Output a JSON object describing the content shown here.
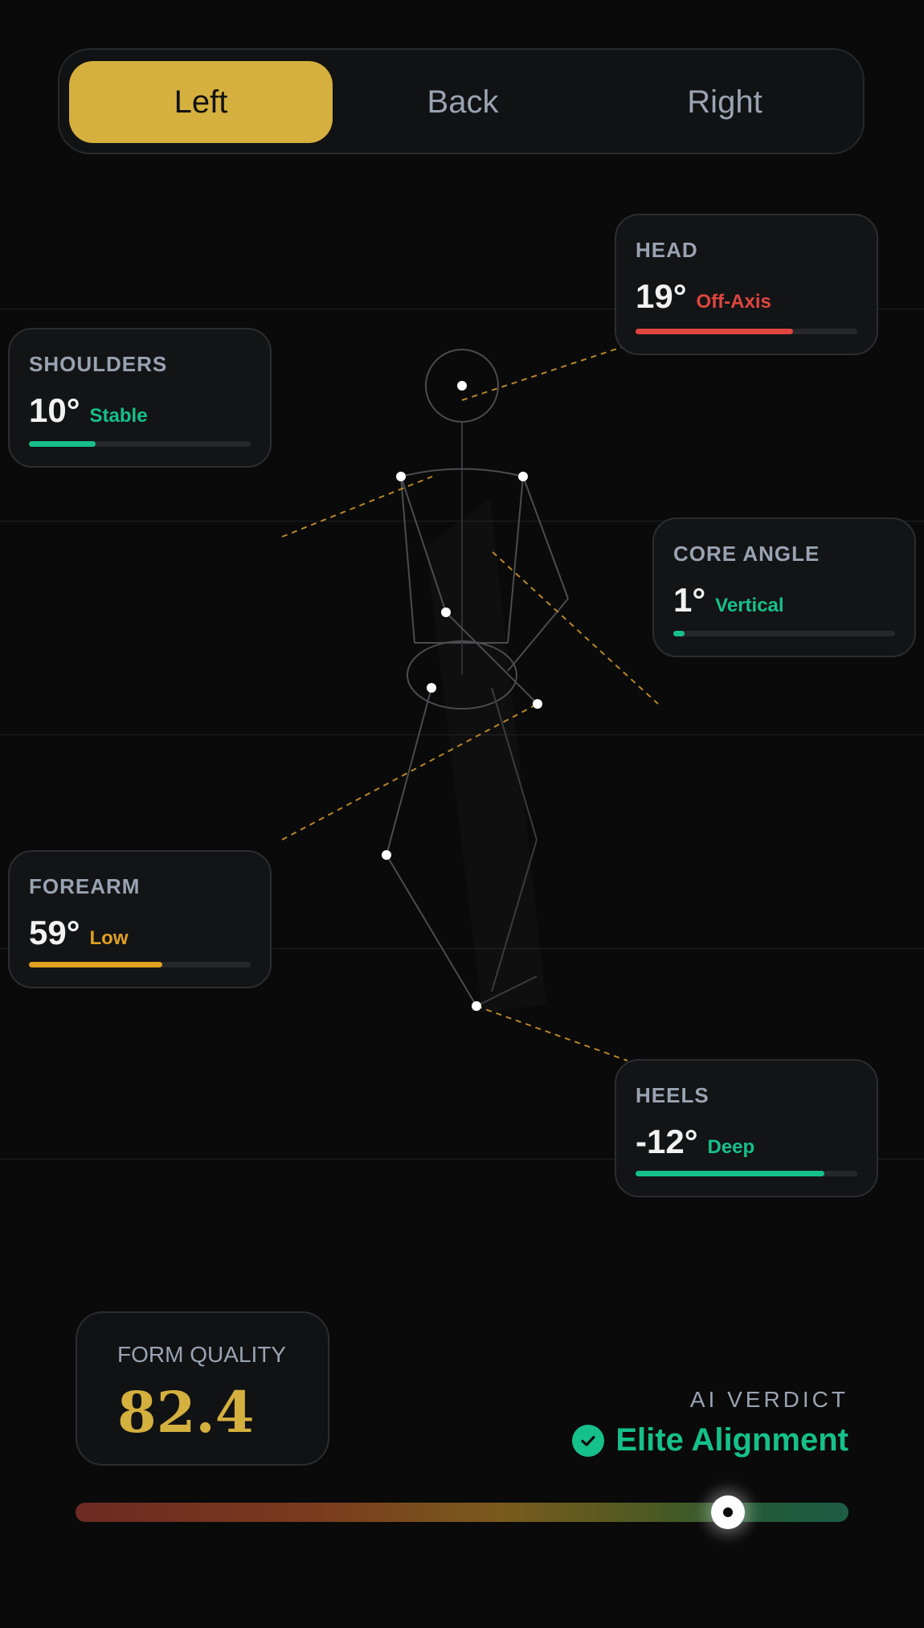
{
  "views": {
    "tabs": [
      {
        "label": "Left",
        "active": true
      },
      {
        "label": "Back",
        "active": false
      },
      {
        "label": "Right",
        "active": false
      }
    ]
  },
  "metrics": {
    "head": {
      "label": "HEAD",
      "value": "19°",
      "status": "Off-Axis",
      "status_color": "#e0453f",
      "level": 0.71
    },
    "shoulders": {
      "label": "SHOULDERS",
      "value": "10°",
      "status": "Stable",
      "status_color": "#16c08a",
      "level": 0.3
    },
    "core": {
      "label": "CORE ANGLE",
      "value": "1°",
      "status": "Vertical",
      "status_color": "#16c08a",
      "level": 0.05
    },
    "forearm": {
      "label": "FOREARM",
      "value": "59°",
      "status": "Low",
      "status_color": "#e0a022",
      "level": 0.6
    },
    "heels": {
      "label": "HEELS",
      "value": "-12°",
      "status": "Deep",
      "status_color": "#16c08a",
      "level": 0.85
    }
  },
  "form_quality": {
    "label": "FORM QUALITY",
    "score": "82.4"
  },
  "verdict": {
    "label": "AI VERDICT",
    "text": "Elite Alignment",
    "icon": "check-circle-icon",
    "color": "#16c08a"
  },
  "gauge": {
    "level": 0.844
  },
  "colors": {
    "accent": "#d5b03e",
    "background": "#0a0a0a"
  }
}
